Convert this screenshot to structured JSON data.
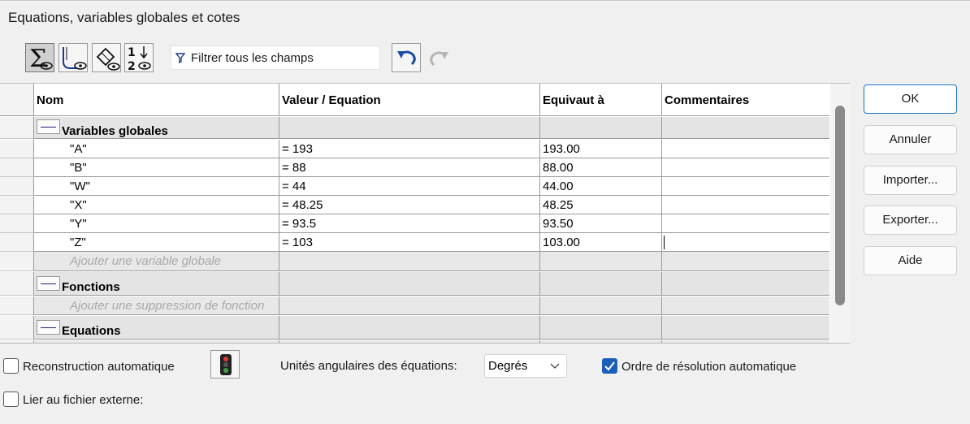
{
  "window": {
    "title": "Equations, variables globales et cotes"
  },
  "toolbar": {
    "buttons": [
      {
        "name": "sigma-eye",
        "label": "Vue des équations"
      },
      {
        "name": "sketch-eye",
        "label": "Vue des cotes d'esquisse"
      },
      {
        "name": "dimension-eye",
        "label": "Vue des cotes"
      },
      {
        "name": "order-eye",
        "label": "Vue ordonnée"
      }
    ],
    "filter_placeholder": "Filtrer tous les champs"
  },
  "table": {
    "headers": [
      "Nom",
      "Valeur / Equation",
      "Equivaut à",
      "Commentaires"
    ],
    "groups": [
      {
        "title": "Variables globales",
        "rows": [
          {
            "name": "\"A\"",
            "value": "= 193",
            "result": "193.00",
            "comment": ""
          },
          {
            "name": "\"B\"",
            "value": "= 88",
            "result": "88.00",
            "comment": ""
          },
          {
            "name": "\"W\"",
            "value": "= 44",
            "result": "44.00",
            "comment": ""
          },
          {
            "name": "\"X\"",
            "value": "= 48.25",
            "result": "48.25",
            "comment": ""
          },
          {
            "name": "\"Y\"",
            "value": "= 93.5",
            "result": "93.50",
            "comment": ""
          },
          {
            "name": "\"Z\"",
            "value": "= 103",
            "result": "103.00",
            "comment": ""
          }
        ],
        "add_text": "Ajouter une variable globale"
      },
      {
        "title": "Fonctions",
        "rows": [],
        "add_text": "Ajouter une suppression de fonction"
      },
      {
        "title": "Equations",
        "rows": [],
        "add_text": ""
      }
    ]
  },
  "buttons": {
    "ok": "OK",
    "cancel": "Annuler",
    "import": "Importer...",
    "export": "Exporter...",
    "help": "Aide"
  },
  "footer": {
    "auto_rebuild": {
      "label": "Reconstruction automatique",
      "checked": false
    },
    "angular_units_label": "Unités angulaires des équations:",
    "angular_units_value": "Degrés",
    "auto_solve_order": {
      "label": "Ordre de résolution automatique",
      "checked": true
    },
    "link_external": {
      "label": "Lier au fichier externe:",
      "checked": false
    }
  },
  "colors": {
    "accent": "#1a60b8",
    "primary_border": "#1a73c8",
    "group_bg": "#e4e4e4"
  }
}
